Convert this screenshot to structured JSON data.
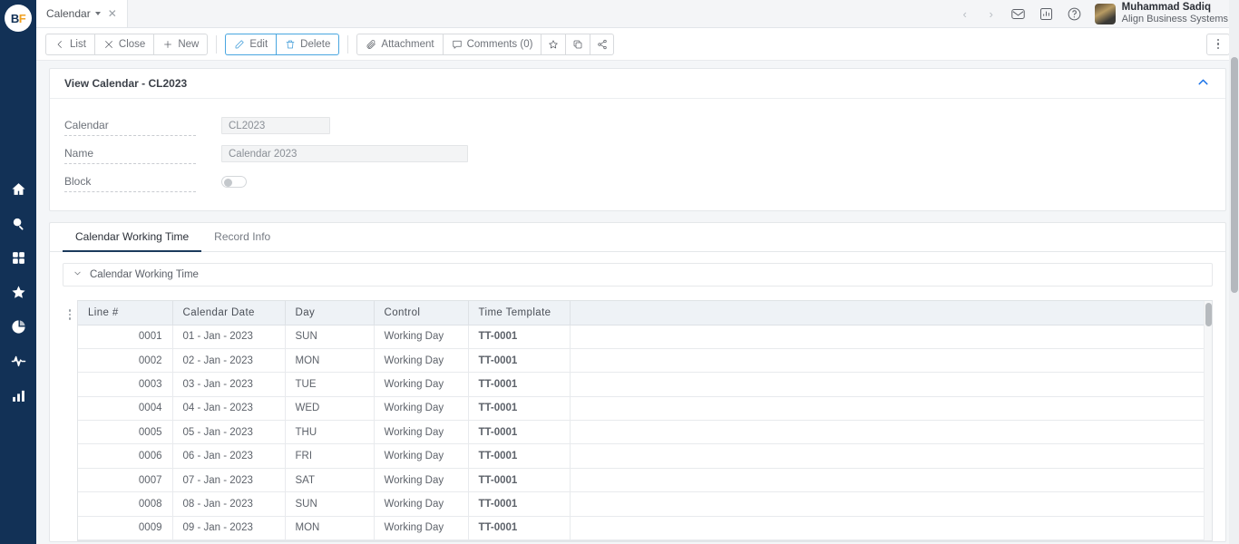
{
  "brand": {
    "logo_b": "B",
    "logo_f": "F"
  },
  "sidebar": {
    "items": [
      {
        "name": "home-icon",
        "label": "Home"
      },
      {
        "name": "search-icon",
        "label": "Search"
      },
      {
        "name": "apps-grid-icon",
        "label": "Apps"
      },
      {
        "name": "star-icon",
        "label": "Favorites"
      },
      {
        "name": "pie-chart-icon",
        "label": "Reports"
      },
      {
        "name": "activity-pulse-icon",
        "label": "Activity"
      },
      {
        "name": "bar-chart-icon",
        "label": "Analytics"
      }
    ]
  },
  "tabstrip": {
    "document_tab": "Calendar",
    "close_glyph": "✕",
    "nav_prev": "‹",
    "nav_next": "›",
    "icons": [
      {
        "name": "mail-icon"
      },
      {
        "name": "chart-report-icon"
      },
      {
        "name": "help-question-icon"
      }
    ],
    "user_name": "Muhammad Sadiq",
    "user_org": "Align Business Systems"
  },
  "toolbar": {
    "list_label": "List",
    "close_label": "Close",
    "new_label": "New",
    "edit_label": "Edit",
    "delete_label": "Delete",
    "attachment_label": "Attachment",
    "comments_label": "Comments (0)",
    "favorite_icon": "star-icon",
    "duplicate_icon": "copy-icon",
    "share_icon": "share-icon",
    "more_icon": "kebab-menu-icon"
  },
  "record": {
    "header_title": "View Calendar - CL2023",
    "fields": [
      {
        "label": "Calendar",
        "value": "CL2023",
        "type": "text",
        "width": "w1"
      },
      {
        "label": "Name",
        "value": "Calendar 2023",
        "type": "text",
        "width": "w2"
      },
      {
        "label": "Block",
        "value": "",
        "type": "toggle",
        "checked": false
      }
    ]
  },
  "tabs": [
    {
      "label": "Calendar Working Time",
      "active": true
    },
    {
      "label": "Record Info",
      "active": false
    }
  ],
  "section": {
    "label": "Calendar Working Time"
  },
  "grid": {
    "columns": [
      "Line #",
      "Calendar Date",
      "Day",
      "Control",
      "Time Template",
      ""
    ],
    "rows": [
      {
        "line": "0001",
        "date": "01 - Jan - 2023",
        "day": "SUN",
        "control": "Working Day",
        "template": "TT-0001"
      },
      {
        "line": "0002",
        "date": "02 - Jan - 2023",
        "day": "MON",
        "control": "Working Day",
        "template": "TT-0001"
      },
      {
        "line": "0003",
        "date": "03 - Jan - 2023",
        "day": "TUE",
        "control": "Working Day",
        "template": "TT-0001"
      },
      {
        "line": "0004",
        "date": "04 - Jan - 2023",
        "day": "WED",
        "control": "Working Day",
        "template": "TT-0001"
      },
      {
        "line": "0005",
        "date": "05 - Jan - 2023",
        "day": "THU",
        "control": "Working Day",
        "template": "TT-0001"
      },
      {
        "line": "0006",
        "date": "06 - Jan - 2023",
        "day": "FRI",
        "control": "Working Day",
        "template": "TT-0001"
      },
      {
        "line": "0007",
        "date": "07 - Jan - 2023",
        "day": "SAT",
        "control": "Working Day",
        "template": "TT-0001"
      },
      {
        "line": "0008",
        "date": "08 - Jan - 2023",
        "day": "SUN",
        "control": "Working Day",
        "template": "TT-0001"
      },
      {
        "line": "0009",
        "date": "09 - Jan - 2023",
        "day": "MON",
        "control": "Working Day",
        "template": "TT-0001"
      }
    ]
  },
  "colors": {
    "rail": "#123156",
    "accent_blue": "#1a73e8",
    "link_blue": "#2a6dbd",
    "logo_gold": "#f0a020",
    "grid_header": "#eef2f6"
  }
}
